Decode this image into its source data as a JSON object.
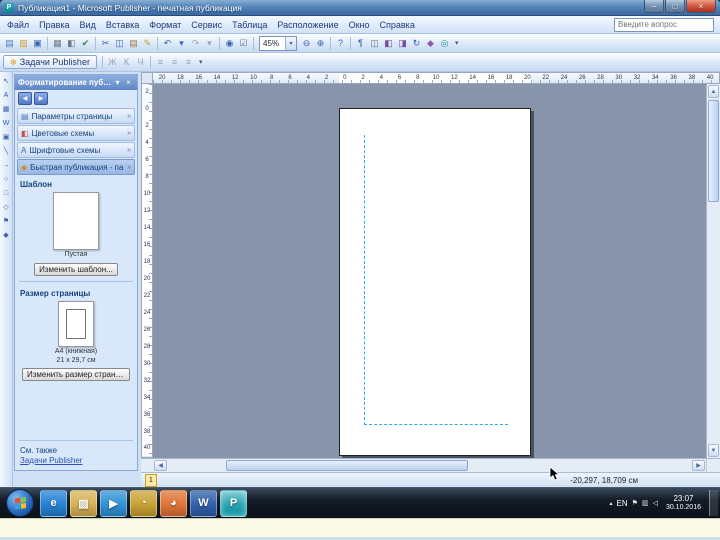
{
  "window": {
    "title": "Публикация1 - Microsoft Publisher - печатная публикация",
    "app_icon_glyph": "P",
    "controls": [
      {
        "name": "minimize-button",
        "glyph": "–"
      },
      {
        "name": "maximize-button",
        "glyph": "□"
      },
      {
        "name": "close-button",
        "glyph": "×"
      }
    ]
  },
  "menubar": {
    "items": [
      "Файл",
      "Правка",
      "Вид",
      "Вставка",
      "Формат",
      "Сервис",
      "Таблица",
      "Расположение",
      "Окно",
      "Справка"
    ],
    "help_box_placeholder": "Введите вопрос"
  },
  "toolbar": {
    "zoom_value": "45%",
    "zoom_dd_glyph": "▾",
    "more_glyph": "▾",
    "icons_left": [
      {
        "name": "new-document-icon",
        "glyph": "▤",
        "color": "#4a76c0"
      },
      {
        "name": "open-icon",
        "glyph": "▨",
        "color": "#d8a030"
      },
      {
        "name": "save-icon",
        "glyph": "▣",
        "color": "#3a66b0"
      },
      {
        "sep": true
      },
      {
        "name": "print-icon",
        "glyph": "▦",
        "color": "#66788a"
      },
      {
        "name": "print-preview-icon",
        "glyph": "◧",
        "color": "#66788a"
      },
      {
        "name": "spelling-icon",
        "glyph": "✔",
        "color": "#2a8a3a"
      },
      {
        "sep": true
      },
      {
        "name": "cut-icon",
        "glyph": "✂",
        "color": "#3a5fae"
      },
      {
        "name": "copy-icon",
        "glyph": "◫",
        "color": "#3a5fae"
      },
      {
        "name": "paste-icon",
        "glyph": "▤",
        "color": "#a07840"
      },
      {
        "name": "format-painter-icon",
        "glyph": "✎",
        "color": "#c8a020"
      },
      {
        "sep": true
      },
      {
        "name": "undo-icon",
        "glyph": "↶",
        "color": "#3a5fae"
      },
      {
        "name": "undo-dropdown-icon",
        "glyph": "▾",
        "color": "#3a5fae"
      },
      {
        "name": "redo-icon",
        "glyph": "↷",
        "disabled": true
      },
      {
        "name": "redo-dropdown-icon",
        "glyph": "▾",
        "disabled": true
      },
      {
        "sep": true
      },
      {
        "name": "insert-hyperlink-icon",
        "glyph": "◉",
        "color": "#3a5fae"
      },
      {
        "name": "design-checker-icon",
        "glyph": "☑",
        "color": "#66788a"
      },
      {
        "sep": true
      }
    ],
    "icons_right": [
      {
        "name": "zoom-out-icon",
        "glyph": "⊖",
        "color": "#3a5fae"
      },
      {
        "name": "zoom-in-icon",
        "glyph": "⊕",
        "color": "#3a5fae"
      },
      {
        "sep": true
      },
      {
        "name": "help-icon",
        "glyph": "?",
        "color": "#2a6ac0"
      },
      {
        "sep": true
      },
      {
        "name": "special-characters-icon",
        "glyph": "¶",
        "color": "#3a5fae"
      },
      {
        "name": "two-page-spread-icon",
        "glyph": "◫",
        "color": "#66788a"
      },
      {
        "name": "bring-to-front-icon",
        "glyph": "◧",
        "color": "#7a4aa0"
      },
      {
        "name": "send-to-back-icon",
        "glyph": "◨",
        "color": "#7a4aa0"
      },
      {
        "name": "free-rotate-icon",
        "glyph": "↻",
        "color": "#3a5fae"
      },
      {
        "name": "design-gallery-icon",
        "glyph": "◆",
        "color": "#8a5ab0"
      },
      {
        "name": "research-icon",
        "glyph": "◎",
        "color": "#2a8a9a"
      }
    ]
  },
  "toolbar2": {
    "tasks_label": "Задачи Publisher",
    "tasks_icon_glyph": "✻",
    "icons": [
      {
        "sep": true
      },
      {
        "name": "bold-icon",
        "glyph": "Ж",
        "disabled": true
      },
      {
        "name": "italic-icon",
        "glyph": "К",
        "disabled": true
      },
      {
        "name": "underline-icon",
        "glyph": "Ч",
        "disabled": true
      },
      {
        "sep": true
      },
      {
        "name": "align-left-icon",
        "glyph": "≡",
        "disabled": true
      },
      {
        "name": "align-center-icon",
        "glyph": "≡",
        "disabled": true
      },
      {
        "name": "align-right-icon",
        "glyph": "≡",
        "disabled": true
      }
    ]
  },
  "objects_toolbar": {
    "tools": [
      {
        "name": "select-tool",
        "glyph": "↖"
      },
      {
        "name": "text-box-tool",
        "glyph": "A"
      },
      {
        "name": "insert-table-tool",
        "glyph": "▦"
      },
      {
        "name": "wordart-tool",
        "glyph": "W"
      },
      {
        "name": "picture-frame-tool",
        "glyph": "▣"
      },
      {
        "name": "line-tool",
        "glyph": "╲"
      },
      {
        "name": "arrow-tool",
        "glyph": "→"
      },
      {
        "name": "oval-tool",
        "glyph": "○"
      },
      {
        "name": "rectangle-tool",
        "glyph": "□"
      },
      {
        "name": "autoshapes-tool",
        "glyph": "◇"
      },
      {
        "name": "bookmark-tool",
        "glyph": "⚑"
      },
      {
        "name": "design-gallery-object-tool",
        "glyph": "◆"
      }
    ]
  },
  "taskpane": {
    "title": "Форматирование публикации",
    "dropdown_glyph": "▾",
    "close_glyph": "×",
    "back_glyph": "◀",
    "forward_glyph": "▶",
    "sections": [
      {
        "name": "section-page-options",
        "label": "Параметры страницы",
        "glyph": "▤",
        "color": "#4a76c0",
        "chev": "»"
      },
      {
        "name": "section-color-schemes",
        "label": "Цветовые схемы",
        "glyph": "◧",
        "color": "#c05040",
        "chev": "»"
      },
      {
        "name": "section-font-schemes",
        "label": "Шрифтовые схемы",
        "glyph": "А",
        "color": "#3a66b0",
        "chev": "»"
      },
      {
        "name": "section-quick-publication",
        "label": "Быстрая публикация - па...",
        "glyph": "◆",
        "color": "#d89020",
        "chev": "»",
        "active": true
      }
    ],
    "template_section": {
      "heading": "Шаблон",
      "thumb_caption": "Пустая",
      "change_button": "Изменить шаблон..."
    },
    "page_size_section": {
      "heading": "Размер страницы",
      "caption_line1": "A4 (книжная)",
      "caption_line2": "21 x 29,7 см",
      "change_button": "Изменить размер страниц..."
    },
    "see_also_heading": "См. также",
    "see_also_link": "Задачи Publisher"
  },
  "rulers": {
    "horizontal_numbers": [
      "20",
      "18",
      "16",
      "14",
      "12",
      "10",
      "8",
      "6",
      "4",
      "2",
      "0",
      "2",
      "4",
      "6",
      "8",
      "10",
      "12",
      "14",
      "16",
      "18",
      "20",
      "22",
      "24",
      "26",
      "28",
      "30",
      "32",
      "34",
      "36",
      "38",
      "40"
    ],
    "vertical_numbers": [
      "2",
      "0",
      "2",
      "4",
      "6",
      "8",
      "10",
      "12",
      "14",
      "16",
      "18",
      "20",
      "22",
      "24",
      "26",
      "28",
      "30",
      "32",
      "34",
      "36",
      "38",
      "40"
    ]
  },
  "scrollbars": {
    "up": "▲",
    "down": "▼",
    "left": "◀",
    "right": "▶"
  },
  "statusbar": {
    "page_number": "1",
    "position": "-20,297, 18,709 см"
  },
  "taskbar": {
    "apps": [
      {
        "name": "taskbar-internet-explorer",
        "glyph": "e",
        "bg": "#1e7fd4"
      },
      {
        "name": "taskbar-windows-explorer",
        "glyph": "▨",
        "bg": "#d8b050"
      },
      {
        "name": "taskbar-media-player",
        "glyph": "▶",
        "bg": "#2a8fd4"
      },
      {
        "name": "taskbar-chrome",
        "glyph": "◔",
        "bg": "#c8a030"
      },
      {
        "name": "taskbar-firefox",
        "glyph": "◕",
        "bg": "#e07030"
      },
      {
        "name": "taskbar-word",
        "glyph": "W",
        "bg": "#2a5caa"
      },
      {
        "name": "taskbar-publisher",
        "glyph": "P",
        "bg": "#0a98a8",
        "active": true
      }
    ],
    "tray": {
      "chevron_glyph": "▴",
      "lang": "EN",
      "icons": [
        {
          "name": "action-center-icon",
          "glyph": "⚑"
        },
        {
          "name": "network-icon",
          "glyph": "▥"
        },
        {
          "name": "volume-icon",
          "glyph": "◁"
        }
      ],
      "time": "23:07",
      "date": "30.10.2016"
    }
  },
  "colors": {
    "titlebar": "#4a7ab8",
    "toolbar_bg": "#d8e6f8",
    "canvas_bg": "#8894aa",
    "pane_bg": "#d8e8fa",
    "accent_blue": "#3a5fae",
    "guide_cyan": "#2ab0d8",
    "taskbar_bg": "#141c28",
    "bottom_strip": "#fbf9e8"
  }
}
